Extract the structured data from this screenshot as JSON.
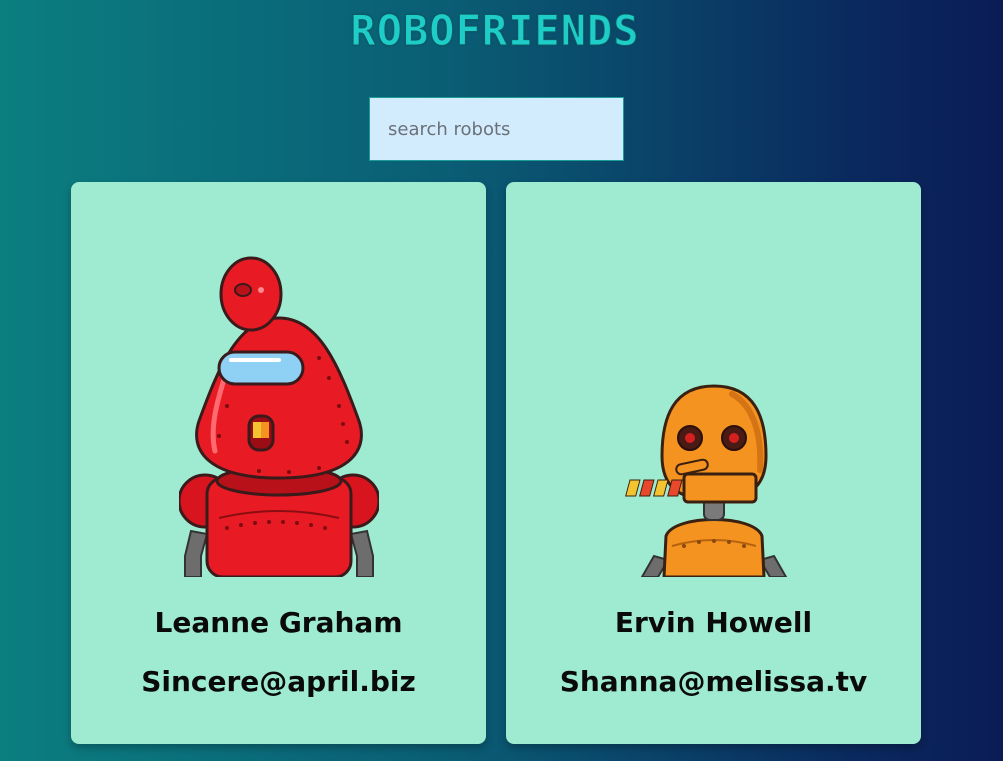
{
  "header": {
    "title": "ROBOFRIENDS"
  },
  "search": {
    "placeholder": "search robots",
    "value": ""
  },
  "robots": [
    {
      "name": "Leanne Graham",
      "email": "Sincere@april.biz",
      "avatar_icon": "red-robot-icon",
      "color": "#e81b25"
    },
    {
      "name": "Ervin Howell",
      "email": "Shanna@melissa.tv",
      "avatar_icon": "orange-robot-icon",
      "color": "#f4931f"
    }
  ],
  "colors": {
    "title": "#1ecdc8",
    "card_background": "#9eebd1",
    "search_background": "#d2ecfe"
  }
}
